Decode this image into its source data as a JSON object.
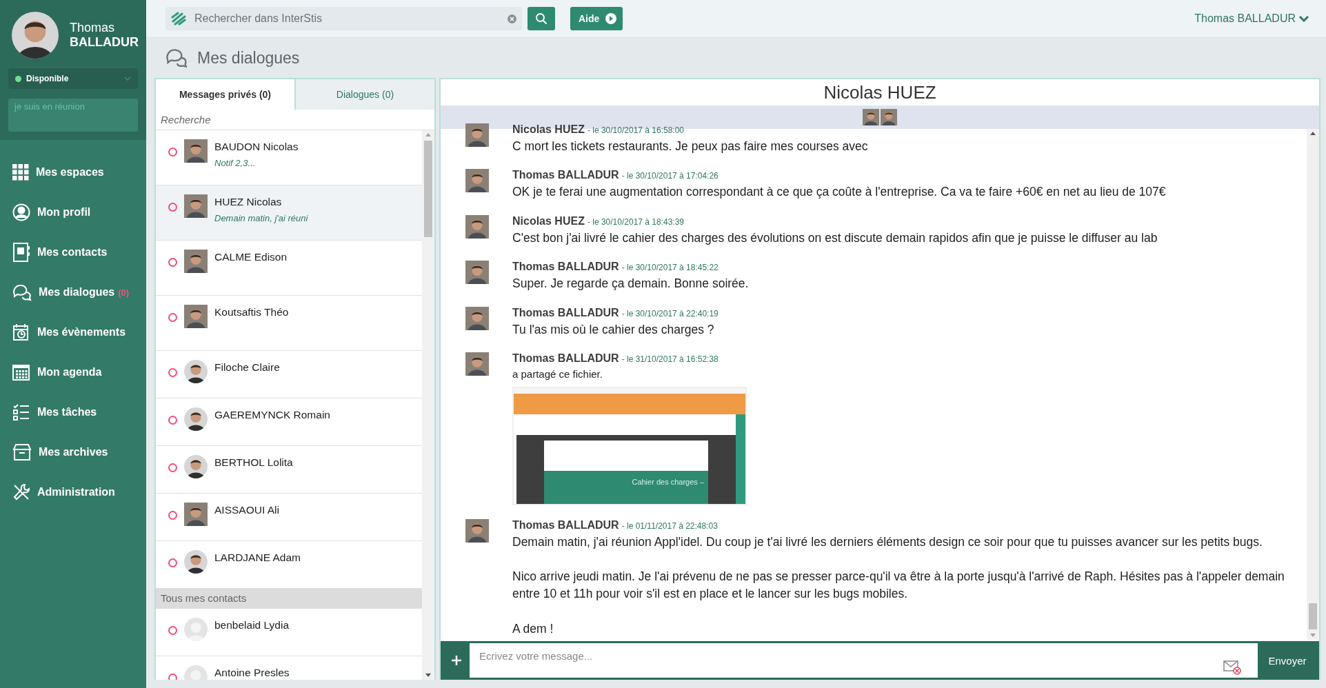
{
  "user": {
    "first_name": "Thomas",
    "last_name": "BALLADUR",
    "status": "Disponible",
    "online": true,
    "mood_placeholder": "je suis en réunion"
  },
  "nav": [
    {
      "label": "Mes espaces"
    },
    {
      "label": "Mon profil"
    },
    {
      "label": "Mes contacts"
    },
    {
      "label": "Mes dialogues",
      "badge": "(0)"
    },
    {
      "label": "Mes évènements"
    },
    {
      "label": "Mon agenda"
    },
    {
      "label": "Mes tâches"
    },
    {
      "label": "Mes archives"
    },
    {
      "label": "Administration"
    }
  ],
  "topbar": {
    "search_placeholder": "Rechercher dans InterStis",
    "help": "Aide",
    "account": "Thomas BALLADUR"
  },
  "page_title": "Mes dialogues",
  "tabs": [
    {
      "label": "Messages privés (0)",
      "selected": true
    },
    {
      "label": "Dialogues (0)",
      "selected": false
    }
  ],
  "contact_search_placeholder": "Recherche",
  "contacts": [
    {
      "name": "BAUDON Nicolas",
      "preview": "Notif 2,3...",
      "kind": "photo",
      "online": false,
      "selected": false
    },
    {
      "name": "HUEZ Nicolas",
      "preview": "Demain matin, j'ai réuni",
      "kind": "photo",
      "online": false,
      "selected": true
    },
    {
      "name": "CALME Edison",
      "kind": "photo",
      "online": false,
      "selected": false
    },
    {
      "name": "Koutsaftis Théo",
      "kind": "photo",
      "online": false,
      "selected": false
    },
    {
      "name": "Filoche Claire",
      "kind": "figure",
      "online": false,
      "selected": false
    },
    {
      "name": "GAEREMYNCK Romain",
      "kind": "figure",
      "online": false,
      "selected": false
    },
    {
      "name": "BERTHOL Lolita",
      "kind": "figure",
      "online": false,
      "selected": false
    },
    {
      "name": "AISSAOUI Ali",
      "kind": "photo",
      "online": false,
      "selected": false
    },
    {
      "name": "LARDJANE Adam",
      "kind": "figure",
      "online": false,
      "selected": false
    }
  ],
  "all_contacts_header": "Tous mes contacts",
  "all_contacts": [
    {
      "name": "benbelaid Lydia",
      "kind": "blank",
      "online": false,
      "selected": false
    },
    {
      "name": "Antoine Presles",
      "kind": "blank",
      "online": false,
      "selected": false
    }
  ],
  "chat": {
    "title": "Nicolas HUEZ",
    "messages": [
      {
        "kind": "text",
        "author": "Nicolas HUEZ",
        "time": "- le 30/10/2017 à 16:58:00",
        "paragraphs": [
          "C mort les tickets restaurants. Je peux pas faire mes courses avec"
        ]
      },
      {
        "kind": "text",
        "author": "Thomas BALLADUR",
        "time": "- le 30/10/2017 à 17:04:26",
        "paragraphs": [
          "OK je te ferai une augmentation correspondant à ce que ça coûte à l'entreprise. Ca va te faire +60€ en net au lieu de 107€"
        ]
      },
      {
        "kind": "text",
        "author": "Nicolas HUEZ",
        "time": "- le 30/10/2017 à 18:43:39",
        "paragraphs": [
          "C'est bon j'ai livré le cahier des charges des évolutions on est discute demain rapidos afin que je puisse le diffuser au lab"
        ]
      },
      {
        "kind": "text",
        "author": "Thomas BALLADUR",
        "time": "- le 30/10/2017 à 18:45:22",
        "paragraphs": [
          "Super. Je regarde ça demain. Bonne soirée."
        ]
      },
      {
        "kind": "text",
        "author": "Thomas BALLADUR",
        "time": "- le 30/10/2017 à 22:40:19",
        "paragraphs": [
          "Tu l'as mis où le cahier des charges ?"
        ]
      },
      {
        "kind": "file",
        "author": "Thomas BALLADUR",
        "time": "- le 31/10/2017 à 16:52:38",
        "paragraphs": [
          "a partagé ce fichier."
        ],
        "file_title": "Cahier des charges –"
      },
      {
        "kind": "text",
        "author": "Thomas BALLADUR",
        "time": "- le 01/11/2017 à 22:48:03",
        "paragraphs": [
          "Demain matin, j'ai réunion Appl'idel. Du coup je t'ai livré les derniers éléments design ce soir pour que tu puisses avancer sur les petits bugs.",
          "Nico arrive jeudi matin. Je l'ai prévenu de ne pas se presser parce-qu'il va être à la porte jusqu'à l'arrivé de Raph. Hésites pas à l'appeler demain entre 10 et 11h pour voir s'il est en place et le lancer sur les bugs mobiles.",
          "A dem !"
        ]
      }
    ],
    "input_placeholder": "Ecrivez votre message...",
    "send": "Envoyer"
  }
}
